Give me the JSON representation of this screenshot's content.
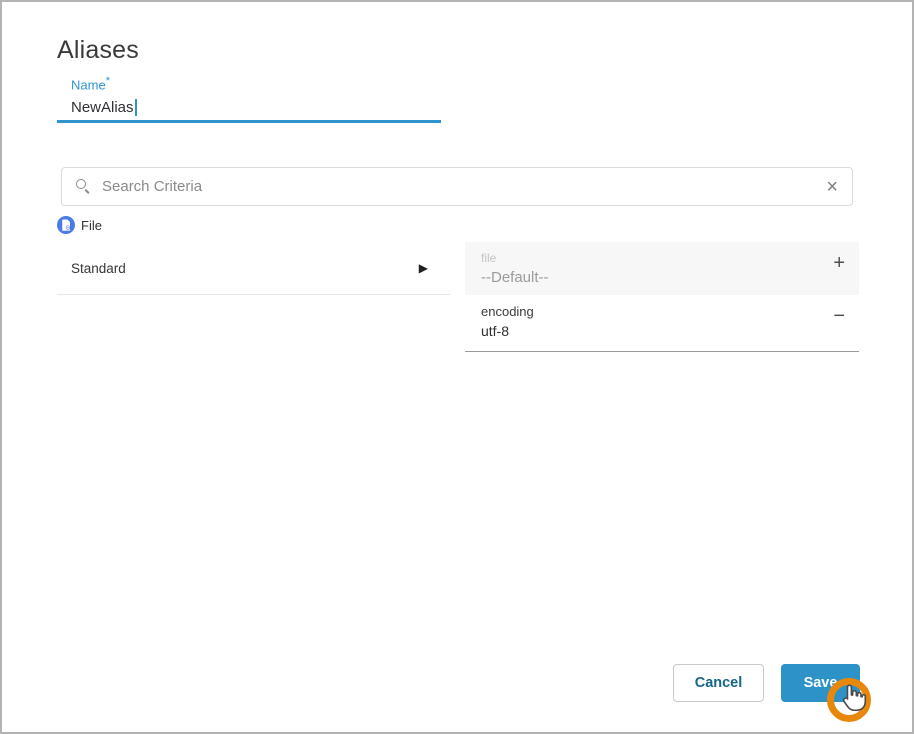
{
  "window": {
    "title": "Aliases"
  },
  "name_field": {
    "label": "Name",
    "required_marker": "*",
    "value": "NewAlias"
  },
  "search": {
    "value": "",
    "placeholder": "Search Criteria",
    "clear_glyph": "×"
  },
  "criteria_type": {
    "label": "File"
  },
  "criteria_tree": {
    "items": [
      {
        "label": "Standard",
        "expand_glyph": "▶"
      }
    ]
  },
  "criteria_fields": [
    {
      "label": "file",
      "value": "--Default--",
      "action": "add",
      "action_glyph": "+"
    },
    {
      "label": "encoding",
      "value": "utf-8",
      "action": "remove",
      "action_glyph": "−"
    }
  ],
  "footer": {
    "cancel_label": "Cancel",
    "save_label": "Save"
  },
  "colors": {
    "accent_blue": "#2e95d3",
    "underline_blue": "#3095ce",
    "save_button_blue": "#2d92c7",
    "cancel_text_blue": "#15658d",
    "chip_icon_blue": "#4b7bea",
    "click_ring_orange": "#e8880b",
    "muted_row_bg": "#f7f7f8"
  }
}
